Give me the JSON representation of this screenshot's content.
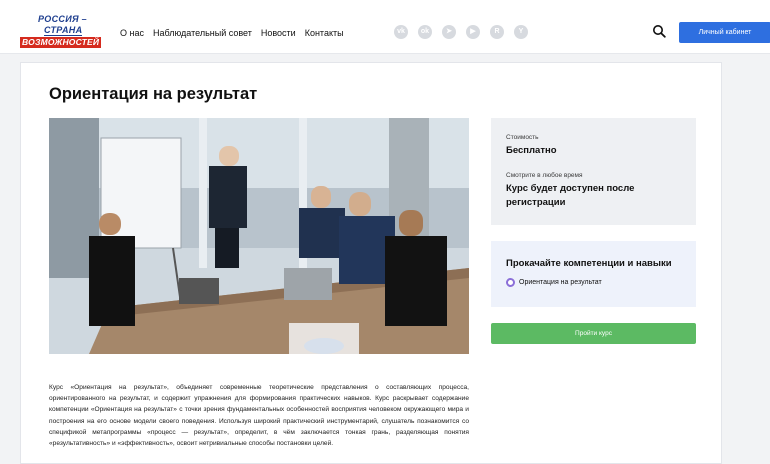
{
  "header": {
    "logo": {
      "line1": "РОССИЯ –",
      "line2": "СТРАНА",
      "line3": "ВОЗМОЖНОСТЕЙ"
    },
    "nav": [
      "О нас",
      "Наблюдательный совет",
      "Новости",
      "Контакты"
    ],
    "socials": [
      "vk-icon",
      "ok-icon",
      "telegram-icon",
      "youtube-icon",
      "rutube-icon",
      "yandex-zen-icon"
    ],
    "cabinet_label": "Личный кабинет"
  },
  "page": {
    "title": "Ориентация на результат",
    "cost_label": "Стоимость",
    "cost_value": "Бесплатно",
    "watch_label": "Смотрите в любое время",
    "watch_value": "Курс будет доступен после регистрации",
    "skills_heading": "Прокачайте компетенции и навыки",
    "skill_tag": "Ориентация на результат",
    "start_label": "Пройти курс",
    "description": "Курс «Ориентация на результат», объединяет современные теоретические представления о составляющих процесса, ориентированного на результат, и содержит упражнения для формирования практических навыков. Курс раскрывает содержание компетенции «Ориентация на результат» с точки зрения фундаментальных особенностей восприятия человеком окружающего мира и построения на его основе модели своего поведения. Используя широкий практический инструментарий, слушатель познакомится со спецификой метапрограммы «процесс — результат», определит, в чём заключается тонкая грань, разделяющая понятия «результативность» и «эффективность», освоит нетривиальные способы постановки целей."
  },
  "colors": {
    "accent": "#2e6fe0",
    "start_button": "#5cba63",
    "logo_red": "#d52b1e",
    "logo_blue": "#1f3f8f"
  }
}
